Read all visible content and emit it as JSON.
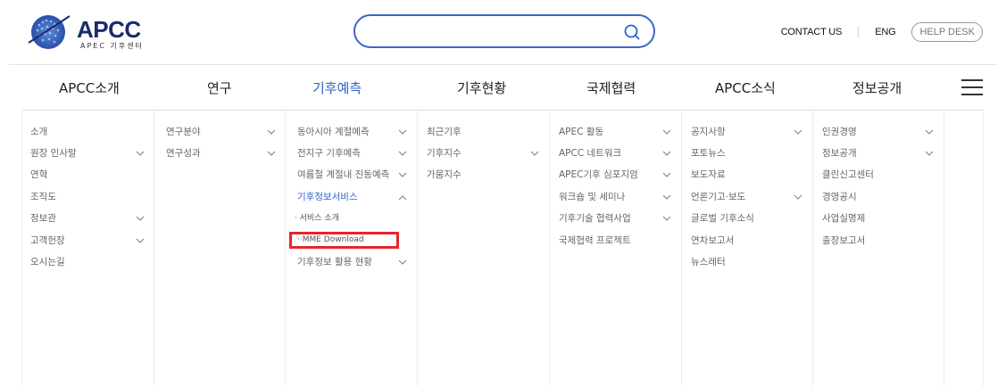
{
  "logo": {
    "brand": "APCC",
    "sub": "APEC 기후센터"
  },
  "search": {
    "placeholder": "",
    "value": ""
  },
  "utils": {
    "contact": "CONTACT US",
    "lang": "ENG",
    "help": "HELP DESK"
  },
  "colors": {
    "accent": "#2b63c9",
    "highlight": "#e8242b",
    "search_border": "#3a67c9"
  },
  "gnb": [
    {
      "label": "APCC소개"
    },
    {
      "label": "연구"
    },
    {
      "label": "기후예측",
      "active": true
    },
    {
      "label": "기후현황"
    },
    {
      "label": "국제협력"
    },
    {
      "label": "APCC소식"
    },
    {
      "label": "정보공개"
    }
  ],
  "menu": {
    "col1": [
      "소개",
      "원장 인사말",
      "연혁",
      "조직도",
      "정보관",
      "고객헌장",
      "오시는길"
    ],
    "col2": [
      "연구분야",
      "연구성과"
    ],
    "col3": [
      "동아시아 계절예측",
      "전지구 기후예측",
      "여름철 계절내 진동예측",
      "기후정보서비스",
      "서비스 소개",
      "MME Download",
      "기후정보 활용 현황"
    ],
    "col4": [
      "최근기후",
      "기후지수",
      "가뭄지수"
    ],
    "col5": [
      "APEC 활동",
      "APCC 네트워크",
      "APEC기후 심포지엄",
      "워크숍 및 세미나",
      "기후기술 협력사업",
      "국제협력 프로젝트"
    ],
    "col6": [
      "공지사항",
      "포토뉴스",
      "보도자료",
      "언론기고·보도",
      "글로벌 기후소식",
      "연차보고서",
      "뉴스레터"
    ],
    "col7": [
      "인권경영",
      "정보공개",
      "클린신고센터",
      "경영공시",
      "사업실명제",
      "출장보고서"
    ]
  },
  "icons": [
    "search-icon",
    "menu-icon",
    "chevron-down-icon",
    "chevron-up-icon"
  ]
}
